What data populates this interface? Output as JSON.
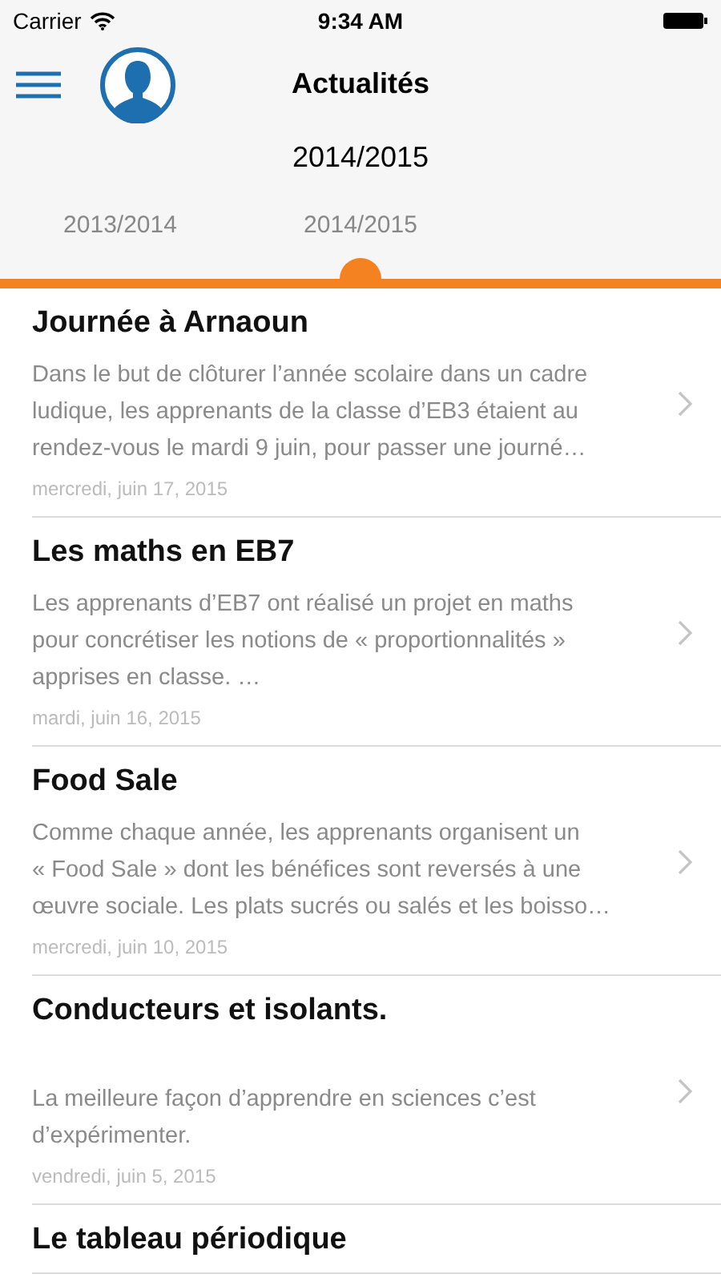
{
  "status_bar": {
    "carrier": "Carrier",
    "time": "9:34 AM"
  },
  "nav": {
    "title": "Actualités",
    "subtitle": "2014/2015"
  },
  "tabs": [
    {
      "label": "2013/2014",
      "selected": false
    },
    {
      "label": "2014/2015",
      "selected": true
    }
  ],
  "news": [
    {
      "title": "Journée à Arnaoun",
      "body_lines": [
        "Dans le but de clôturer l’année scolaire dans un cadre",
        "ludique, les apprenants de la classe d’EB3 étaient au",
        "rendez-vous le mardi 9 juin, pour passer une journé…"
      ],
      "date": "mercredi, juin 17, 2015"
    },
    {
      "title": "Les maths en EB7",
      "body_lines": [
        "Les apprenants d’EB7 ont réalisé un projet en maths",
        "pour concrétiser les notions de « proportionnalités »",
        "apprises en classe. …"
      ],
      "date": "mardi, juin 16, 2015"
    },
    {
      "title": "Food Sale",
      "body_lines": [
        "Comme chaque année, les apprenants organisent  un",
        "« Food Sale » dont les bénéfices sont reversés à une",
        "œuvre sociale. Les plats sucrés ou salés et les boisso…"
      ],
      "date": "mercredi, juin 10, 2015"
    },
    {
      "title": "Conducteurs et isolants.",
      "body_lines": [
        "La meilleure façon d’apprendre en sciences c’est",
        "d’expérimenter."
      ],
      "date": "vendredi, juin 5, 2015"
    },
    {
      "title": "Le tableau périodique"
    }
  ]
}
